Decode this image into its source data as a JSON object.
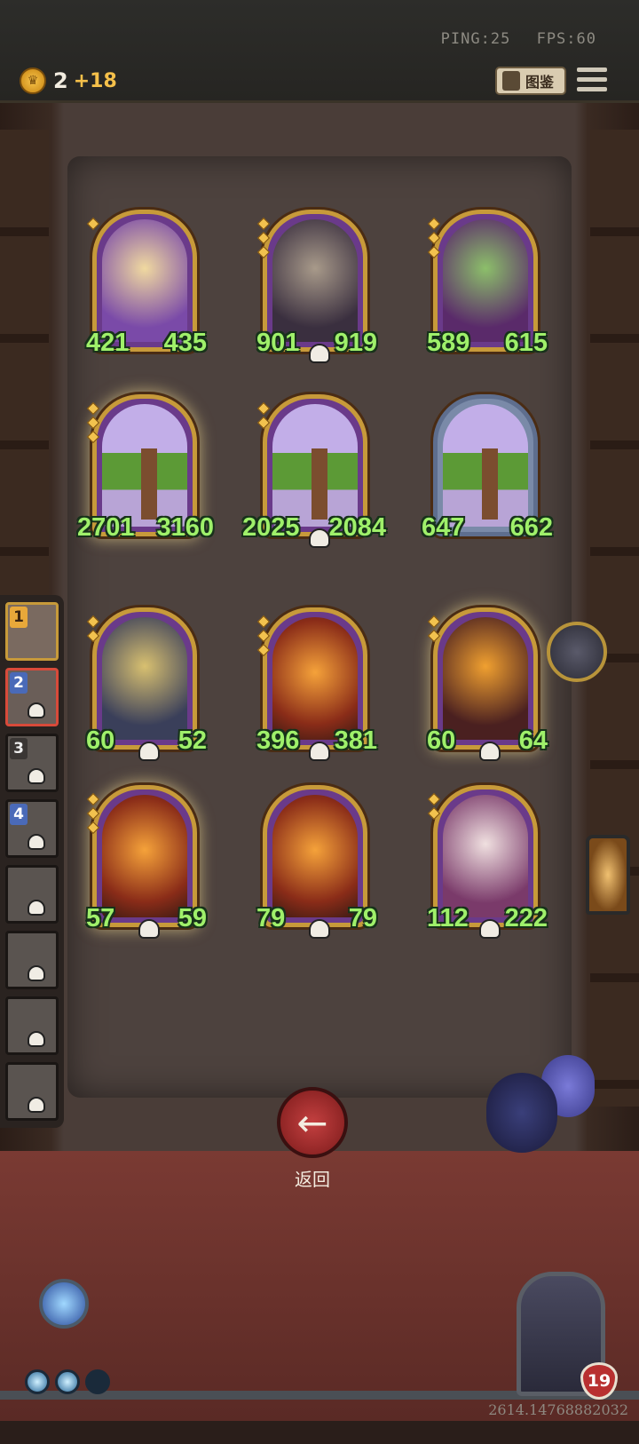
{
  "topbar": {
    "ping": "PING:25",
    "fps": "FPS:60",
    "gold": "2",
    "gold_income": "+18",
    "codex_label": "图鉴"
  },
  "board": {
    "units": [
      {
        "name": "flower-fairy",
        "attack": "421",
        "health": "435"
      },
      {
        "name": "tiki-mask",
        "attack": "901",
        "health": "919"
      },
      {
        "name": "cactus-witch",
        "attack": "589",
        "health": "615"
      },
      {
        "name": "treant",
        "attack": "2701",
        "health": "3160"
      },
      {
        "name": "treant",
        "attack": "2025",
        "health": "2084"
      },
      {
        "name": "treant",
        "attack": "647",
        "health": "662"
      },
      {
        "name": "robot-team",
        "attack": "60",
        "health": "52"
      },
      {
        "name": "flame-rider",
        "attack": "396",
        "health": "381"
      },
      {
        "name": "lava-golem",
        "attack": "60",
        "health": "64"
      },
      {
        "name": "phoenix-angel",
        "attack": "57",
        "health": "59"
      },
      {
        "name": "fire-elemental",
        "attack": "79",
        "health": "79"
      },
      {
        "name": "jester",
        "attack": "112",
        "health": "222"
      }
    ]
  },
  "roster": {
    "ranks": [
      "1",
      "2",
      "3",
      "4"
    ]
  },
  "back_button_label": "返回",
  "player": {
    "health": "19"
  },
  "footer_number": "2614.14768882032"
}
